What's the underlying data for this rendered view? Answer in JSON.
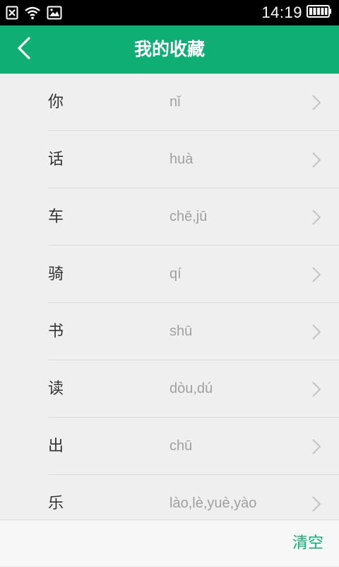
{
  "status_bar": {
    "time": "14:19",
    "icons": [
      "sim-off-icon",
      "wifi-icon",
      "image-notification-icon",
      "battery-icon"
    ]
  },
  "header": {
    "title": "我的收藏",
    "back_icon": "chevron-left-icon",
    "background_color": "#0fae74"
  },
  "favorites": [
    {
      "char": "你",
      "pinyin": "nǐ"
    },
    {
      "char": "话",
      "pinyin": "huà"
    },
    {
      "char": "车",
      "pinyin": "chē,jū"
    },
    {
      "char": "骑",
      "pinyin": "qí"
    },
    {
      "char": "书",
      "pinyin": "shū"
    },
    {
      "char": "读",
      "pinyin": "dòu,dú"
    },
    {
      "char": "出",
      "pinyin": "chū"
    },
    {
      "char": "乐",
      "pinyin": "lào,lè,yuè,yào"
    }
  ],
  "footer": {
    "clear_label": "清空",
    "accent_color": "#0fae74"
  }
}
